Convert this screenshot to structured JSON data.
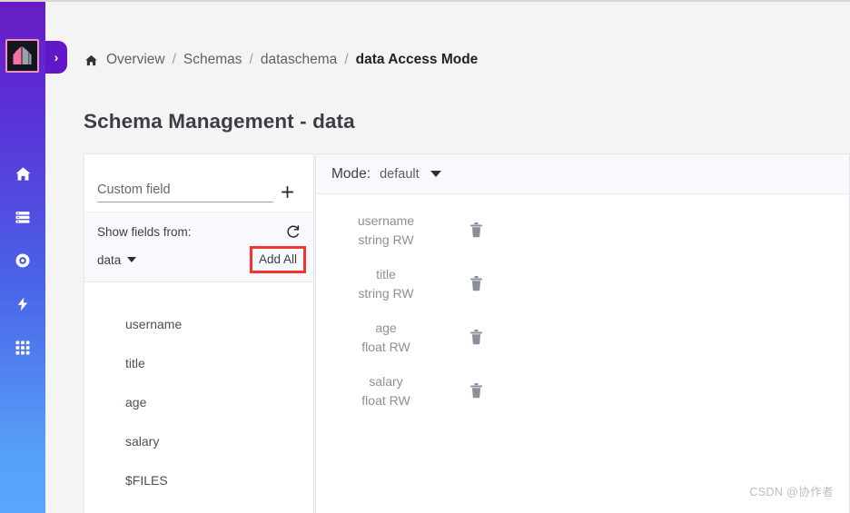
{
  "sidebar": {
    "logo_name": "app-logo",
    "expand_label": "›",
    "items": [
      {
        "icon": "home-icon",
        "name": "home"
      },
      {
        "icon": "list-icon",
        "name": "collections"
      },
      {
        "icon": "disc-icon",
        "name": "storage"
      },
      {
        "icon": "bolt-icon",
        "name": "functions"
      },
      {
        "icon": "grid-icon",
        "name": "apps"
      }
    ]
  },
  "breadcrumb": {
    "home_icon": "home-icon",
    "items": [
      {
        "label": "Overview",
        "active": false
      },
      {
        "label": "Schemas",
        "active": false
      },
      {
        "label": "dataschema",
        "active": false
      },
      {
        "label": "data Access Mode",
        "active": true
      }
    ],
    "separator": "/"
  },
  "page": {
    "title": "Schema Management - data"
  },
  "left_panel": {
    "custom_field": {
      "placeholder": "Custom field",
      "value": "",
      "add_icon": "plus-icon"
    },
    "show_fields_label": "Show fields from:",
    "refresh_icon": "refresh-icon",
    "source_value": "data",
    "add_all_label": "Add All",
    "highlight_color": "#f5352b",
    "fields": [
      "username",
      "title",
      "age",
      "salary",
      "$FILES"
    ]
  },
  "right_panel": {
    "mode_label": "Mode:",
    "mode_value": "default",
    "rows": [
      {
        "name": "username",
        "type": "string RW",
        "delete_icon": "trash-icon"
      },
      {
        "name": "title",
        "type": "string RW",
        "delete_icon": "trash-icon"
      },
      {
        "name": "age",
        "type": "float RW",
        "delete_icon": "trash-icon"
      },
      {
        "name": "salary",
        "type": "float RW",
        "delete_icon": "trash-icon"
      }
    ]
  },
  "watermark": "CSDN @协作者",
  "colors": {
    "rail_top": "#6a1bc4",
    "rail_bottom": "#5aa5fb",
    "accent_red": "#f5352b",
    "page_bg": "#f4f4f4",
    "card_bg": "#ffffff"
  }
}
